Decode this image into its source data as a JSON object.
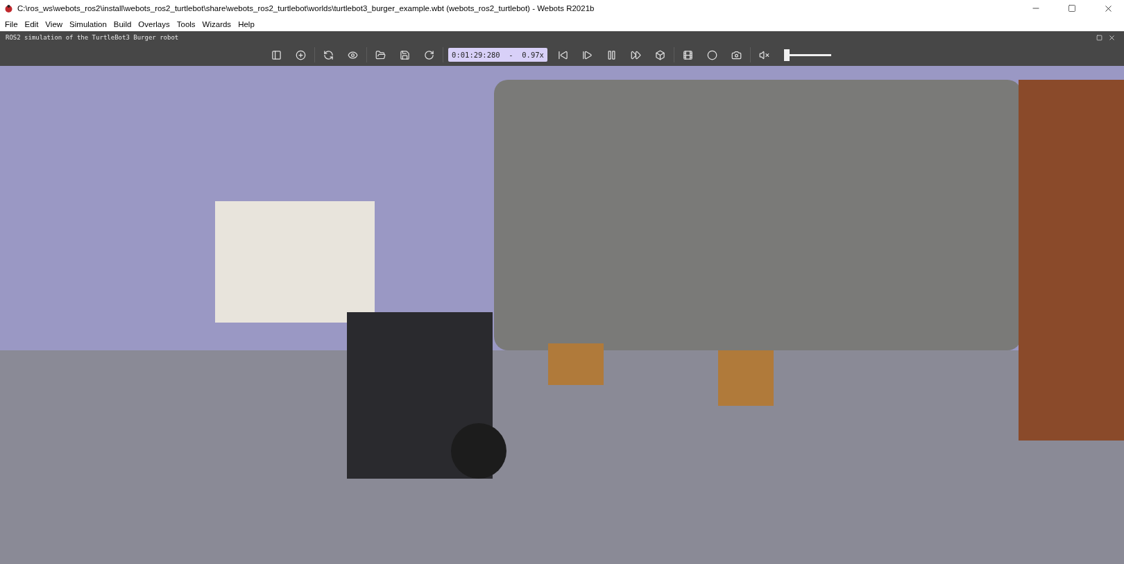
{
  "window": {
    "title": "C:\\ros_ws\\webots_ros2\\install\\webots_ros2_turtlebot\\share\\webots_ros2_turtlebot\\worlds\\turtlebot3_burger_example.wbt (webots_ros2_turtlebot) - Webots R2021b"
  },
  "menu": [
    "File",
    "Edit",
    "View",
    "Simulation",
    "Build",
    "Overlays",
    "Tools",
    "Wizards",
    "Help"
  ],
  "view_panel": {
    "title": "ROS2 simulation of the TurtleBot3 Burger robot"
  },
  "toolbar": {
    "time": "0:01:29:280  -  0.97x",
    "volume": {
      "level": 0.0
    }
  }
}
